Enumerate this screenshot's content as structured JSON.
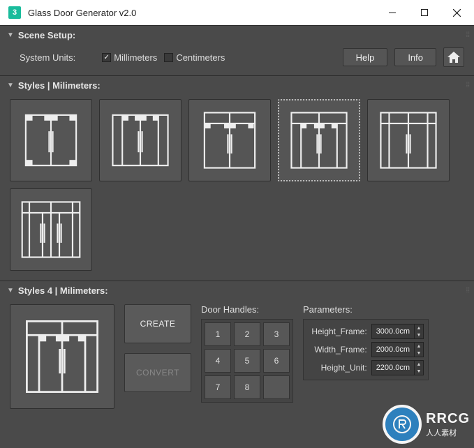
{
  "window": {
    "title": "Glass Door Generator v2.0",
    "app_badge": "3"
  },
  "scene_setup": {
    "title": "Scene Setup:",
    "units_label": "System Units:",
    "millimeters": "Millimeters",
    "centimeters": "Centimeters",
    "millimeters_checked": true,
    "centimeters_checked": false,
    "help": "Help",
    "info": "Info"
  },
  "styles": {
    "title": "Styles | Milimeters:",
    "selected_index": 3
  },
  "styles_detail": {
    "title": "Styles 4 | Milimeters:",
    "create": "CREATE",
    "convert": "CONVERT"
  },
  "door_handles": {
    "title": "Door Handles:",
    "buttons": [
      "1",
      "2",
      "3",
      "4",
      "5",
      "6",
      "7",
      "8"
    ]
  },
  "parameters": {
    "title": "Parameters:",
    "rows": [
      {
        "label": "Height_Frame:",
        "value": "3000.0cm"
      },
      {
        "label": "Width_Frame:",
        "value": "2000.0cm"
      },
      {
        "label": "Height_Unit:",
        "value": "2200.0cm"
      }
    ]
  },
  "watermark": {
    "line1": "RRCG",
    "line2": "人人素材"
  }
}
